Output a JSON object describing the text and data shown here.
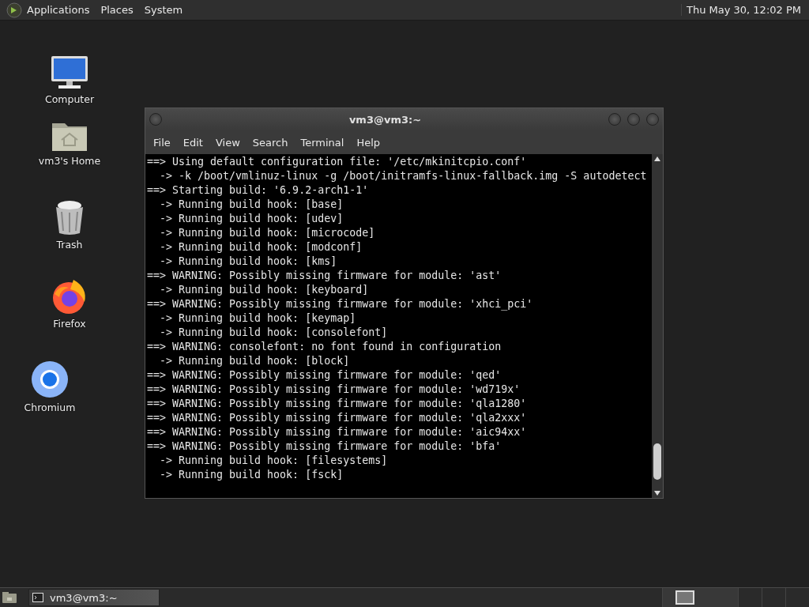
{
  "top_panel": {
    "menus": [
      "Applications",
      "Places",
      "System"
    ],
    "clock": "Thu May 30, 12:02 PM"
  },
  "desktop_icons": [
    {
      "kind": "computer",
      "label": "Computer"
    },
    {
      "kind": "home",
      "label": "vm3's Home"
    },
    {
      "kind": "trash",
      "label": "Trash"
    },
    {
      "kind": "firefox",
      "label": "Firefox"
    },
    {
      "kind": "chromium",
      "label": "Chromium"
    }
  ],
  "window": {
    "title": "vm3@vm3:~",
    "menus": [
      "File",
      "Edit",
      "View",
      "Search",
      "Terminal",
      "Help"
    ],
    "lines": [
      "==> Using default configuration file: '/etc/mkinitcpio.conf'",
      "  -> -k /boot/vmlinuz-linux -g /boot/initramfs-linux-fallback.img -S autodetect",
      "==> Starting build: '6.9.2-arch1-1'",
      "  -> Running build hook: [base]",
      "  -> Running build hook: [udev]",
      "  -> Running build hook: [microcode]",
      "  -> Running build hook: [modconf]",
      "  -> Running build hook: [kms]",
      "==> WARNING: Possibly missing firmware for module: 'ast'",
      "  -> Running build hook: [keyboard]",
      "==> WARNING: Possibly missing firmware for module: 'xhci_pci'",
      "  -> Running build hook: [keymap]",
      "  -> Running build hook: [consolefont]",
      "==> WARNING: consolefont: no font found in configuration",
      "  -> Running build hook: [block]",
      "==> WARNING: Possibly missing firmware for module: 'qed'",
      "==> WARNING: Possibly missing firmware for module: 'wd719x'",
      "==> WARNING: Possibly missing firmware for module: 'qla1280'",
      "==> WARNING: Possibly missing firmware for module: 'qla2xxx'",
      "==> WARNING: Possibly missing firmware for module: 'aic94xx'",
      "==> WARNING: Possibly missing firmware for module: 'bfa'",
      "  -> Running build hook: [filesystems]",
      "  -> Running build hook: [fsck]"
    ]
  },
  "taskbar": {
    "tasks": [
      {
        "label": "vm3@vm3:~",
        "selected": false
      }
    ],
    "workspaces": [
      {
        "selected": true
      },
      {
        "selected": false
      },
      {
        "selected": false
      },
      {
        "selected": false
      }
    ]
  }
}
